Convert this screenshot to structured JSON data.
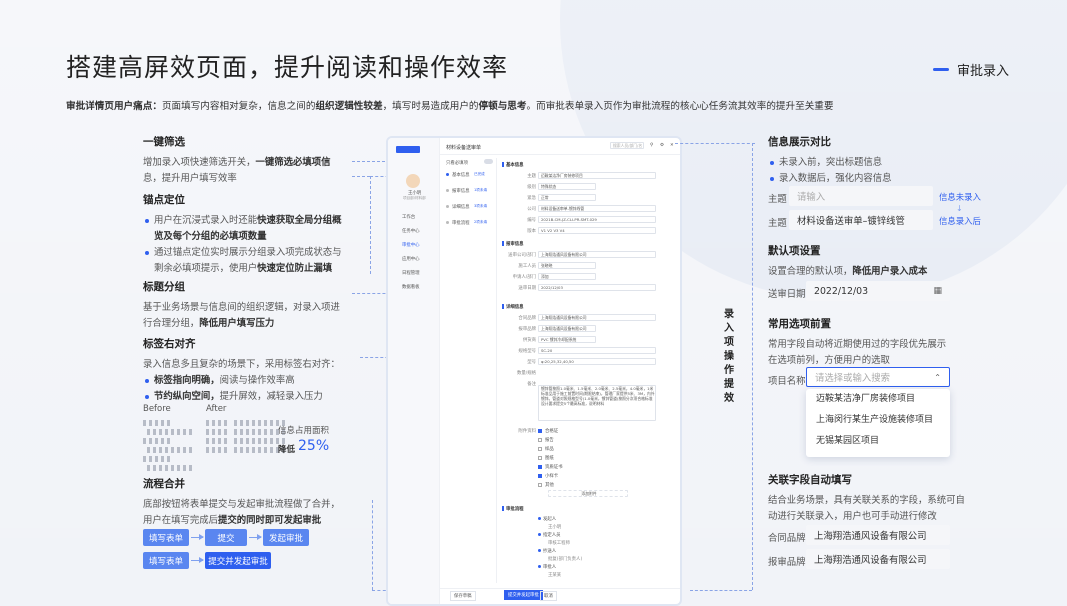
{
  "header": {
    "title": "搭建高屏效页面，提升阅读和操作效率",
    "tag": "审批录入",
    "subtitle_bold": "审批详情页用户痛点：",
    "subtitle_a": "页面填写内容相对复杂，信息之间的",
    "subtitle_b1": "组织逻辑性较差",
    "subtitle_c": "，填写时易造成用户的",
    "subtitle_b2": "停顿与思考",
    "subtitle_d": "。而审批表单录入页作为审批流程的核心心任务流其效率的提升至关重要"
  },
  "left": {
    "s1": {
      "title": "一键筛选",
      "p1": "增加录入项快速筛选开关，",
      "p1b": "一键筛选必填项信",
      "p2": "息，提升用户填写效率"
    },
    "s2": {
      "title": "锚点定位",
      "li1a": "用户在沉浸式录入时还能",
      "li1b": "快速获取全局分组概",
      "li1c": "览及每个分组的必填项数量",
      "li2a": "通过锚点定位实时展示分组录入项完成状态与",
      "li2b": "剩余必填项提示，使用户",
      "li2c": "快速定位防止漏填"
    },
    "s3": {
      "title": "标题分组",
      "p1": "基于业务场景与信息间的组织逻辑，对录入项进",
      "p2a": "行合理分组，",
      "p2b": "降低用户填写压力"
    },
    "s4": {
      "title": "标签右对齐",
      "p1": "录入信息多且复杂的场景下，采用标签右对齐：",
      "li1a": "标签指向明确，",
      "li1b": "阅读与操作效率高",
      "li2a": "节约纵向空间，",
      "li2b": "提升屏效，减轻录入压力",
      "before": "Before",
      "after": "After",
      "area": "信息占用面积",
      "reduce": "降低",
      "pct": "25%"
    },
    "s5": {
      "title": "流程合并",
      "p1": "底部按钮将表单提交与发起审批流程做了合并，",
      "p2a": "用户在填写完成后",
      "p2b": "提交的同时即可发起审批",
      "btn1": "填写表单",
      "btn2": "提交",
      "btn3": "发起审批",
      "btn4": "填写表单",
      "btn5": "提交并发起审批"
    }
  },
  "mock": {
    "header": "材料设备送审单",
    "search": "搜索人员/部门/名",
    "filter_label": "只看必填项",
    "nav": [
      "工作台",
      "任务中心",
      "审批中心",
      "应用中心",
      "日程管理",
      "数据看板"
    ],
    "user": "王小明",
    "user_sub": "项目部/材料部",
    "anchors": [
      "基本信息",
      "报审信息",
      "详细信息",
      "审批流程"
    ],
    "anchor_notes": [
      "已完成",
      "1项未填",
      "3项未填",
      "2项未填"
    ],
    "sec1": "基本信息",
    "sec2": "报审信息",
    "sec3": "详细信息",
    "sec4": "审批流程",
    "f_labels": [
      "主题",
      "级别",
      "紧急",
      "公司",
      "编号",
      "版本"
    ],
    "f_values": [
      "迈鞍某洁净厂房装修项目",
      "特殊状态",
      "正常",
      "材料设备送审单-镀锌线管",
      "2021B-CM-JZ-CLI-PR-SMT-029",
      "V1  V2  V3  V4"
    ],
    "r_labels": [
      "送审公司/部门",
      "施工人员",
      "申请人/部门",
      "送审日期"
    ],
    "r_values": [
      "上海翔浩通风设备有限公司",
      "张晓晓",
      "添加",
      "2022/12/03"
    ],
    "d_labels": [
      "合同品牌",
      "报审品牌",
      "供货商",
      "规格型号",
      "型号",
      "数量/规格",
      "备注"
    ],
    "d_values": [
      "上海翔浩通风设备有限公司",
      "上海翔浩通风设备有限公司",
      "PVC 镀锌冷却配系统",
      "SC-20",
      "φ:20,25,32,40,50"
    ],
    "note": "镀锌管按照1.0毫米、1.5毫米、2.0毫米、2.5毫米，4.0毫米，1米标准品用于施工前置时间(期限结束)，管理厂家提供5米、3M，内外镀锌。管道对照规格型号(1.0毫米，镀锌管道)按照分次项合格标准设计要求提交5个最高标准，说明材料",
    "checks": [
      "合格证",
      "报告",
      "样品",
      "图纸",
      "资质证书",
      "小样卡",
      "其他"
    ],
    "upload": "添加附件",
    "attach_label": "附件资料",
    "flow": [
      "发起人",
      "王小明",
      "指定人员",
      "审核工程师",
      "抄送人",
      "批复(部门负责人)",
      "审批人",
      "王某某"
    ],
    "footer_cancel": "保存草稿",
    "footer_submit": "提交并发起审批",
    "footer_back": "取消"
  },
  "right": {
    "vertical_title": "录入项操作提效",
    "s1": {
      "title": "信息展示对比",
      "li1": "未录入前，突出标题信息",
      "li2": "录入数据后，强化内容信息",
      "lbl": "主题",
      "ph": "请输入",
      "val": "材料设备送审单–镀锌线管",
      "before": "信息未录入",
      "after": "信息录入后"
    },
    "s2": {
      "title": "默认项设置",
      "p1a": "设置合理的默认项，",
      "p1b": "降低用户录入成本",
      "lbl": "送审日期",
      "val": "2022/12/03"
    },
    "s3": {
      "title": "常用选项前置",
      "p1": "常用字段自动将近期使用过的字段优先展示",
      "p2": "在选项前列，方便用户的选取",
      "lbl": "项目名称",
      "ph": "请选择或输入搜索",
      "opts": [
        "迈鞍某洁净厂房装修项目",
        "上海闵行某生产设施装修项目",
        "无锡某园区项目"
      ]
    },
    "s4": {
      "title": "关联字段自动填写",
      "p1": "结合业务场景，具有关联关系的字段，系统可自",
      "p2": "动进行关联录入，用户也可手动进行修改",
      "lbl1": "合同品牌",
      "val1": "上海翔浩通风设备有限公司",
      "lbl2": "报审品牌",
      "val2": "上海翔浩通风设备有限公司"
    }
  },
  "colors": {
    "accent": "#2f5fef",
    "bg": "#f1f3f8"
  }
}
